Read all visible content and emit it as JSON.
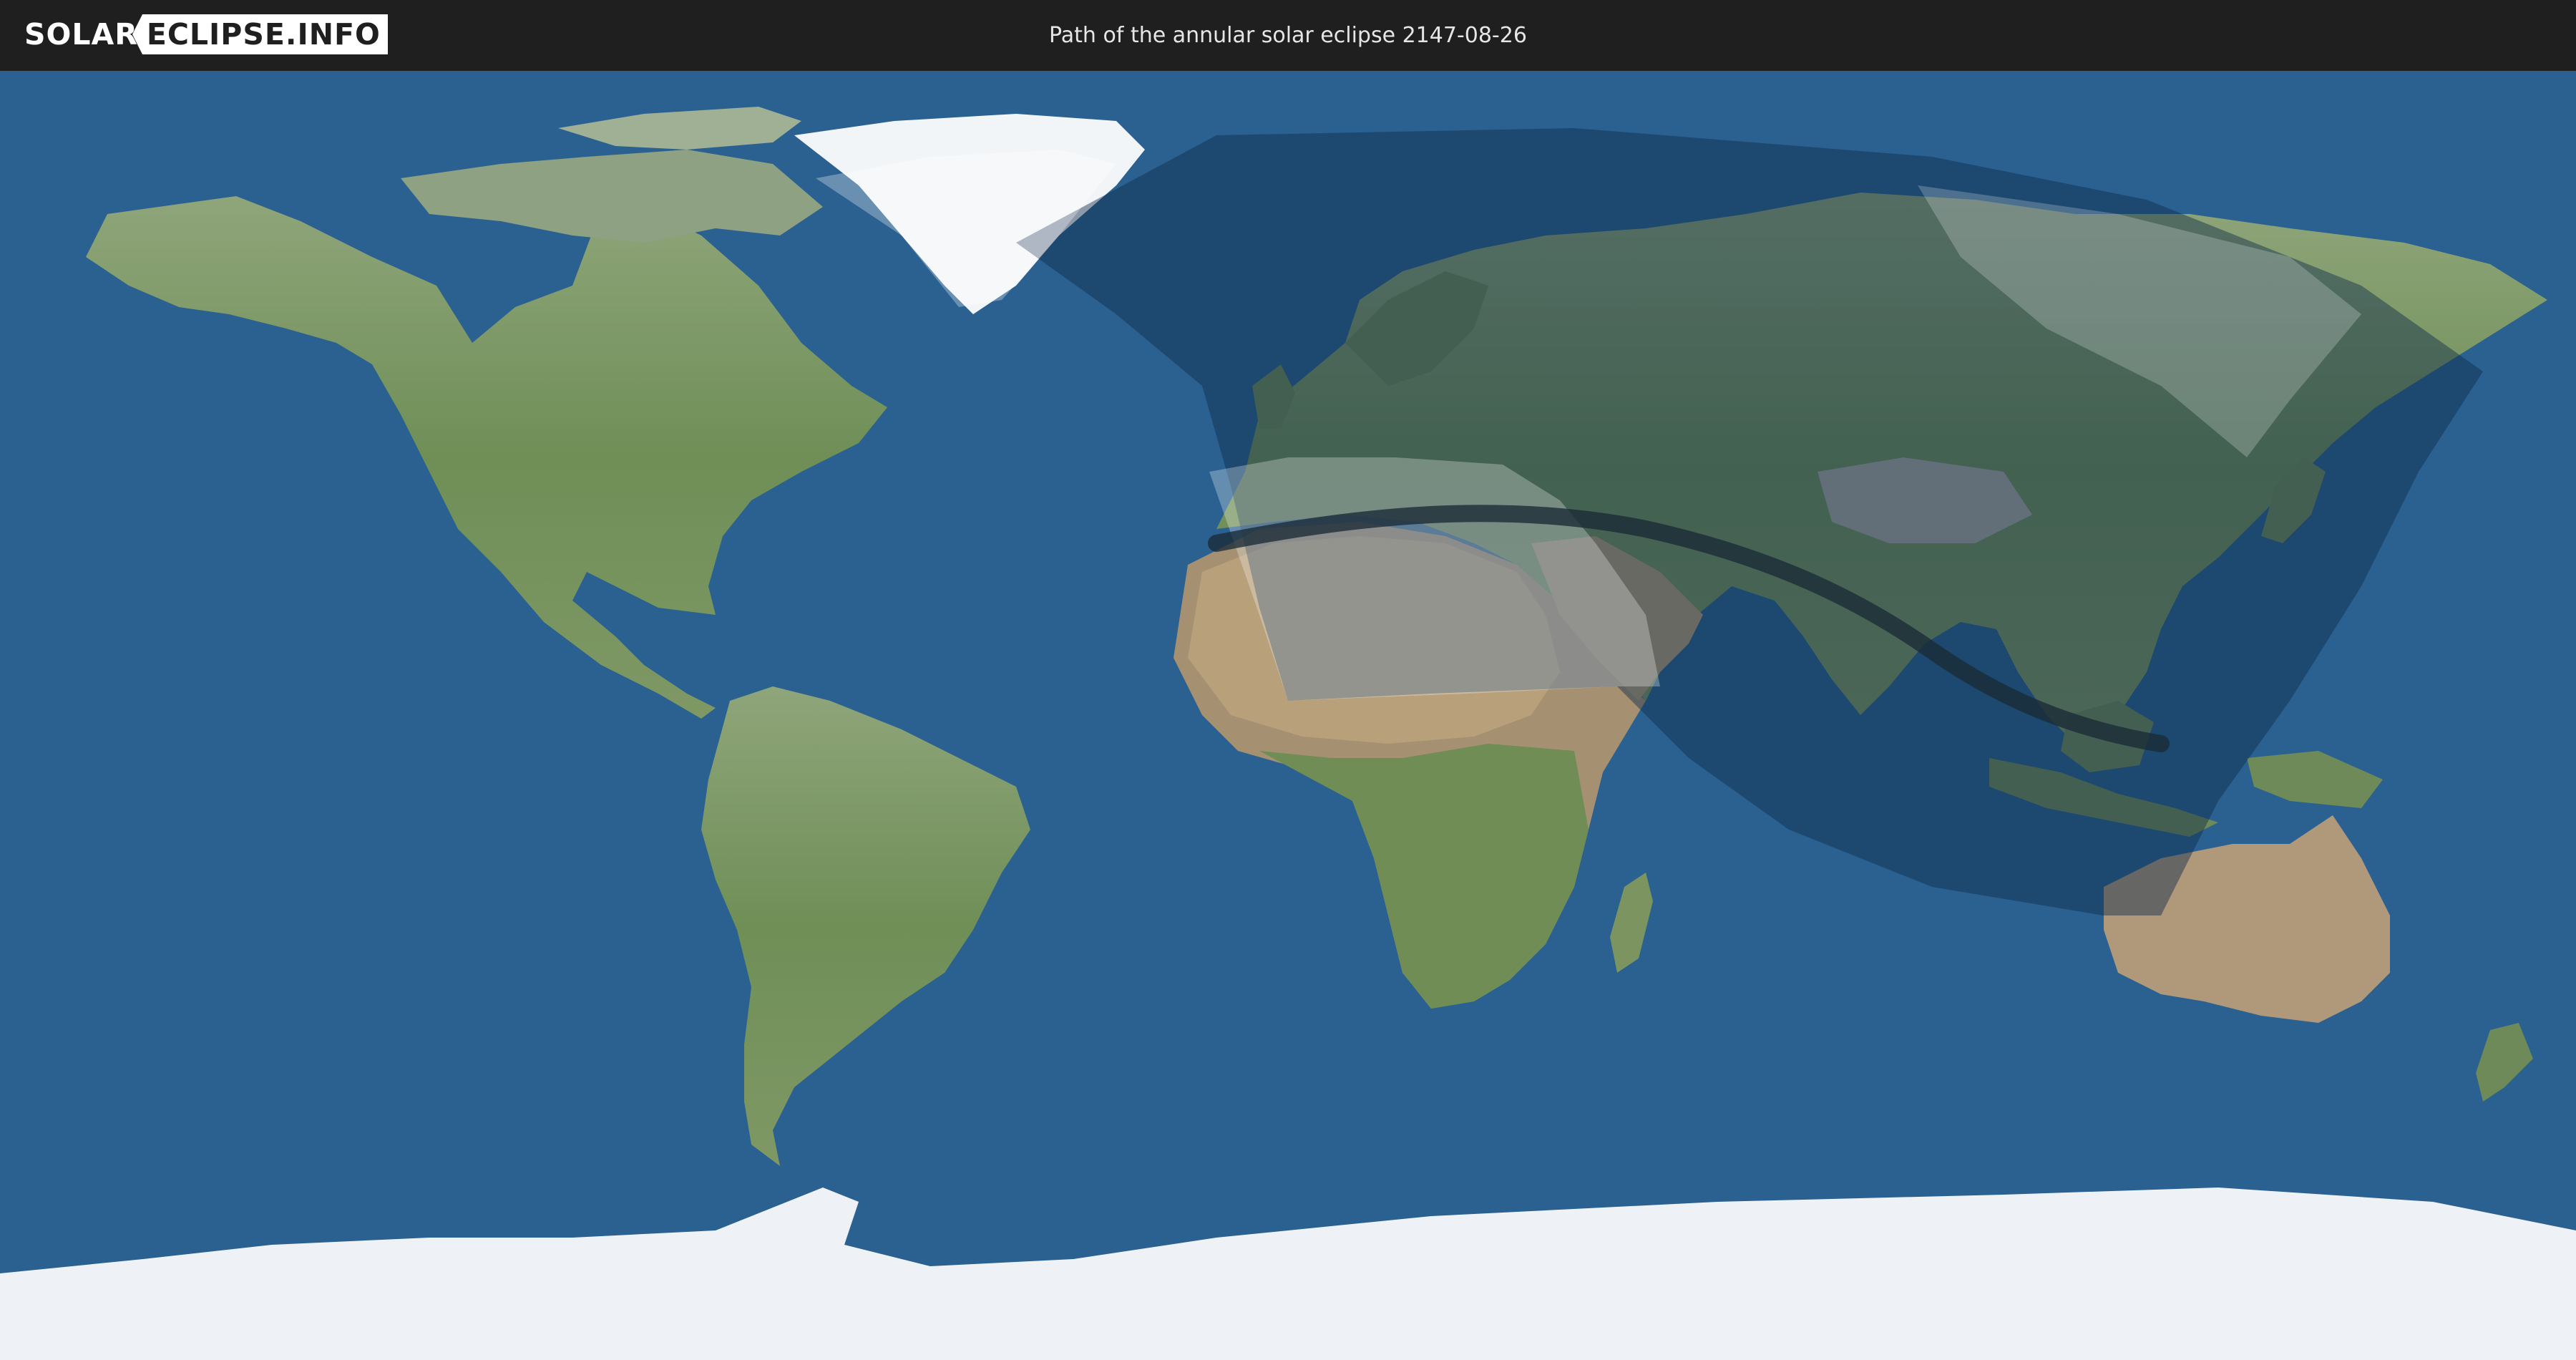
{
  "header": {
    "logo_left": "SOLAR",
    "logo_right": "ECLIPSE.INFO",
    "title": "Path of the annular solar eclipse 2147-08-26"
  },
  "colors": {
    "ocean": "#2a6190",
    "land": "#7d9a66",
    "desert": "#b9a27d",
    "ice": "#eef2f6",
    "header": "#1f1f1f",
    "penumbra_overlay": "#0d2a4a",
    "day_overlay": "#ffffff",
    "central_path": "#1a2a36"
  },
  "map": {
    "projection": "equirectangular",
    "eclipse_type": "annular",
    "date": "2147-08-26"
  }
}
